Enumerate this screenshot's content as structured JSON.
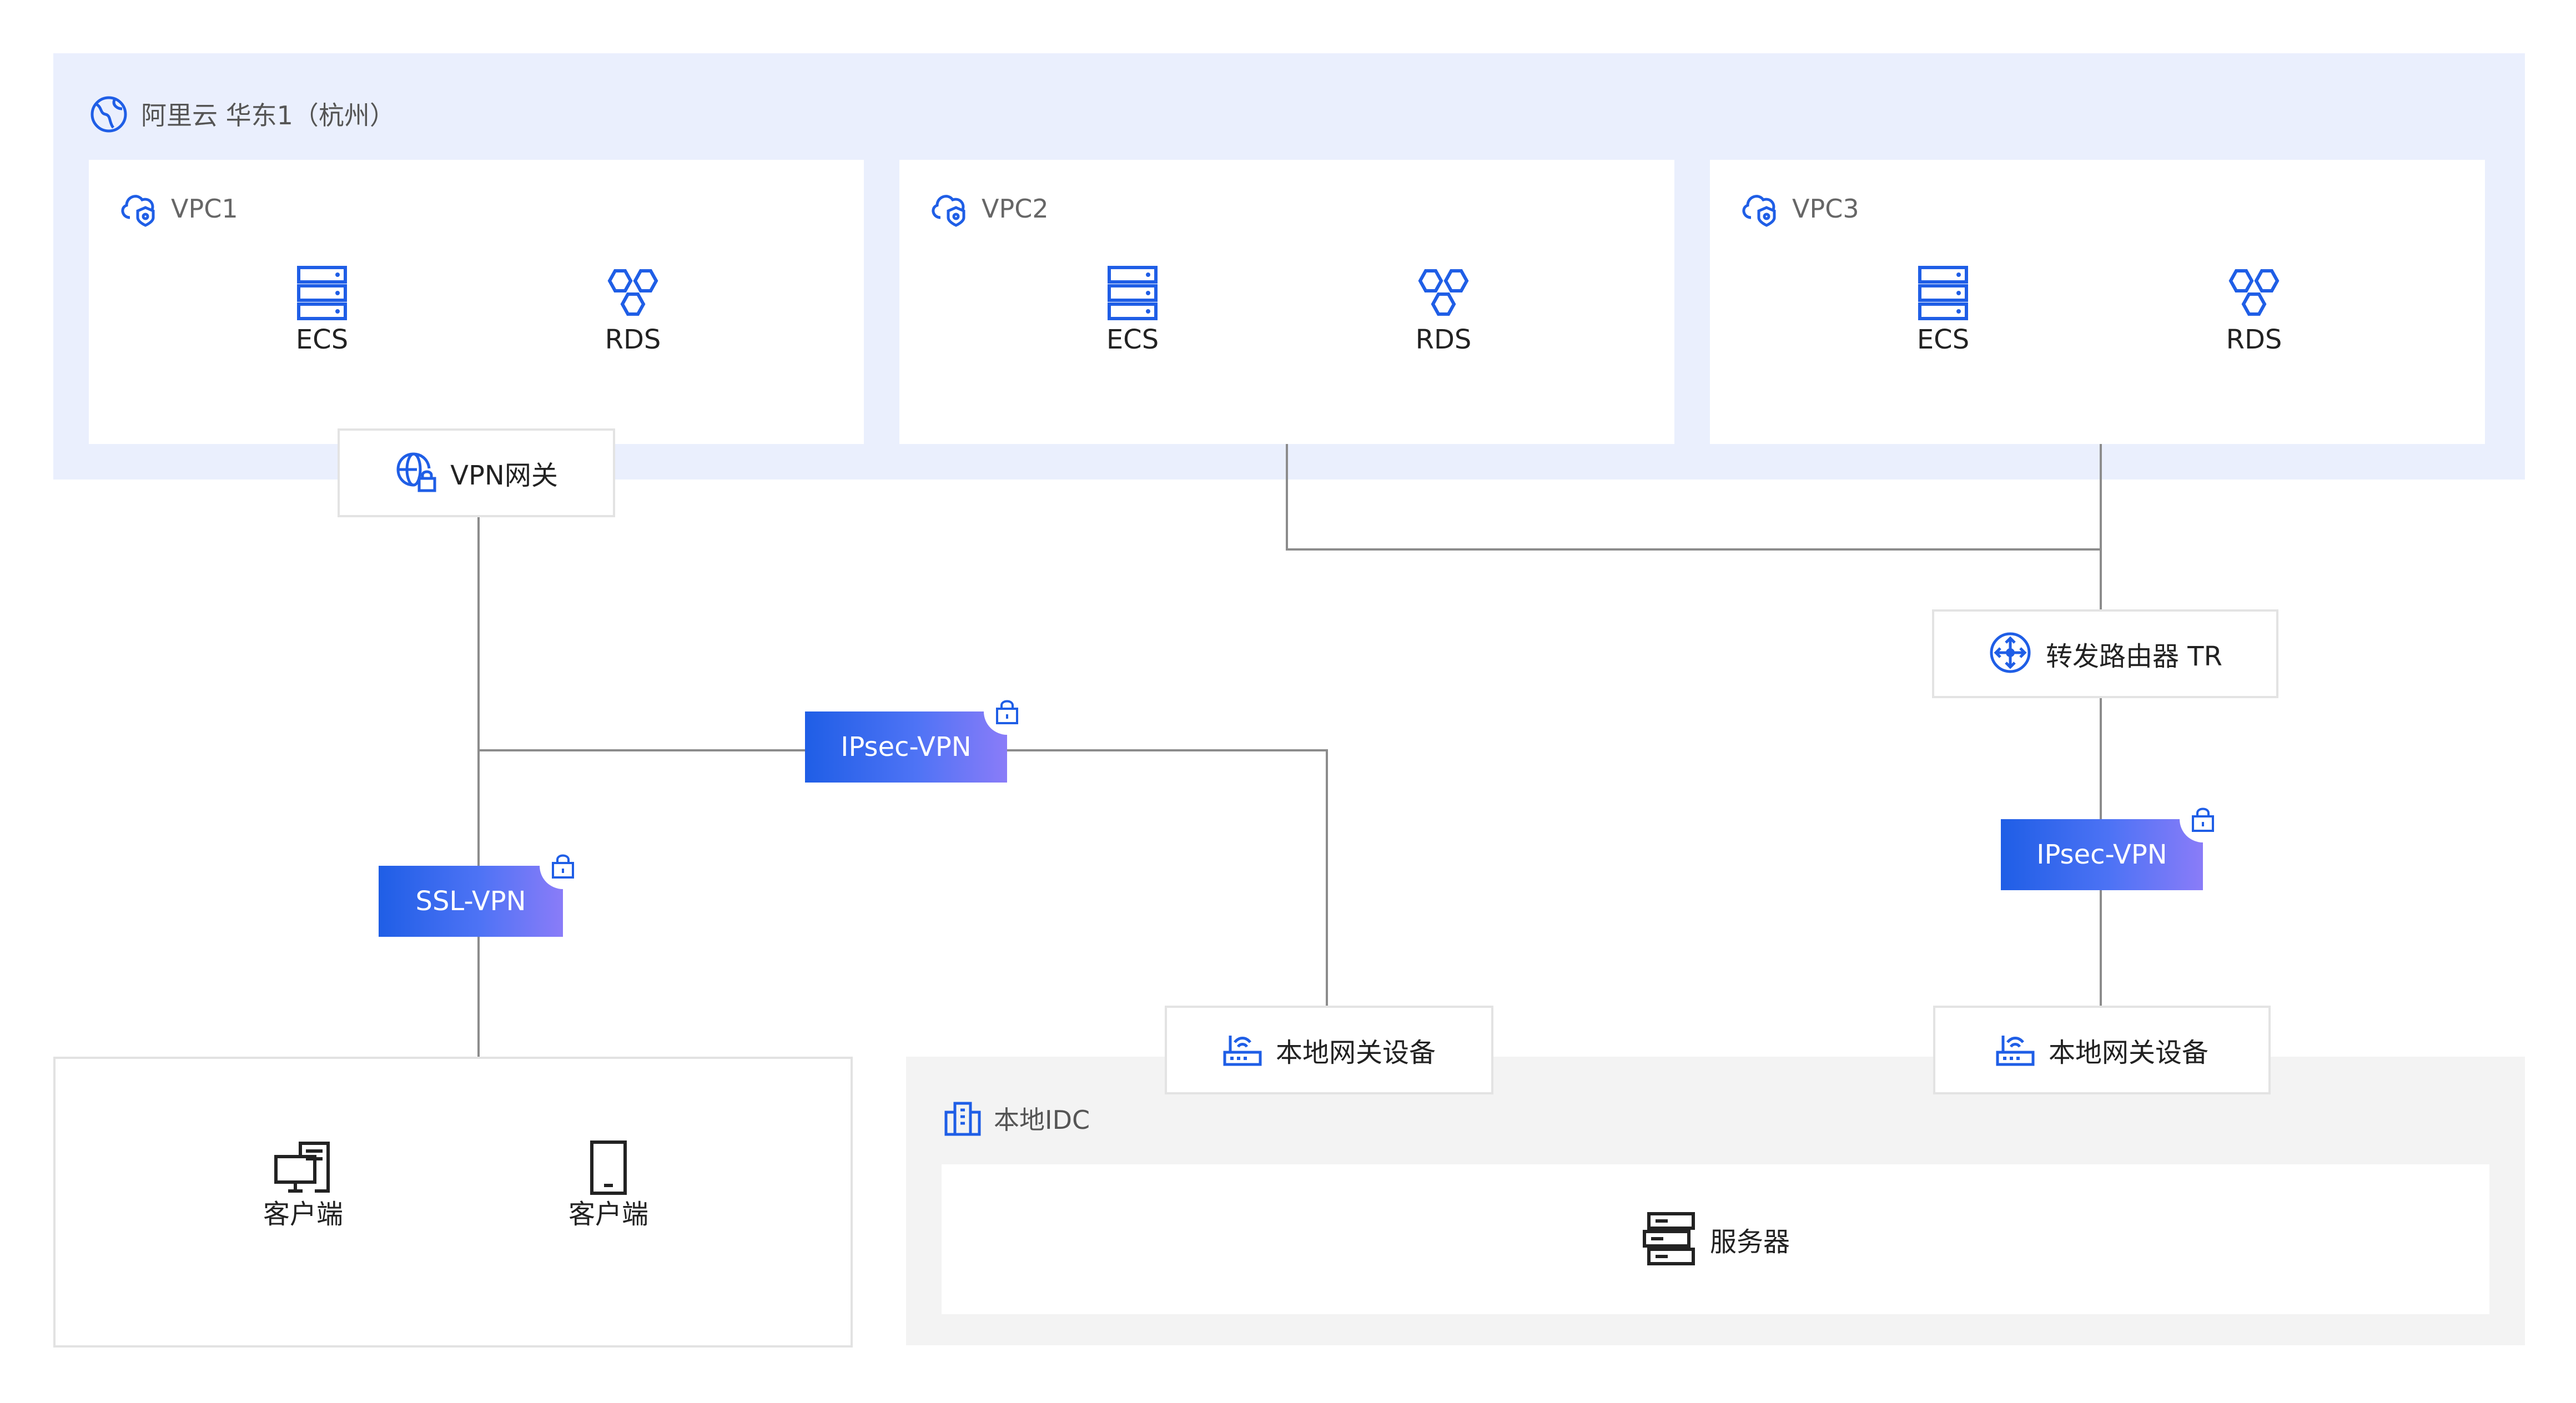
{
  "cloud": {
    "label": "阿里云 华东1（杭州）",
    "vpcs": [
      {
        "label": "VPC1",
        "services": [
          "ECS",
          "RDS"
        ]
      },
      {
        "label": "VPC2",
        "services": [
          "ECS",
          "RDS"
        ]
      },
      {
        "label": "VPC3",
        "services": [
          "ECS",
          "RDS"
        ]
      }
    ],
    "vpn_gateway": "VPN网关",
    "transit_router": "转发路由器 TR"
  },
  "links": {
    "ipsec_left": "IPsec-VPN",
    "ssl": "SSL-VPN",
    "ipsec_right": "IPsec-VPN"
  },
  "idc": {
    "label": "本地IDC",
    "gateway_left": "本地网关设备",
    "gateway_right": "本地网关设备",
    "server": "服务器"
  },
  "clients": {
    "desktop": "客户端",
    "mobile": "客户端"
  },
  "colors": {
    "cloud_bg": "#eaeffd",
    "idc_bg": "#f3f3f3",
    "icon_blue": "#1f5ee6",
    "line": "#8c8c8c"
  }
}
